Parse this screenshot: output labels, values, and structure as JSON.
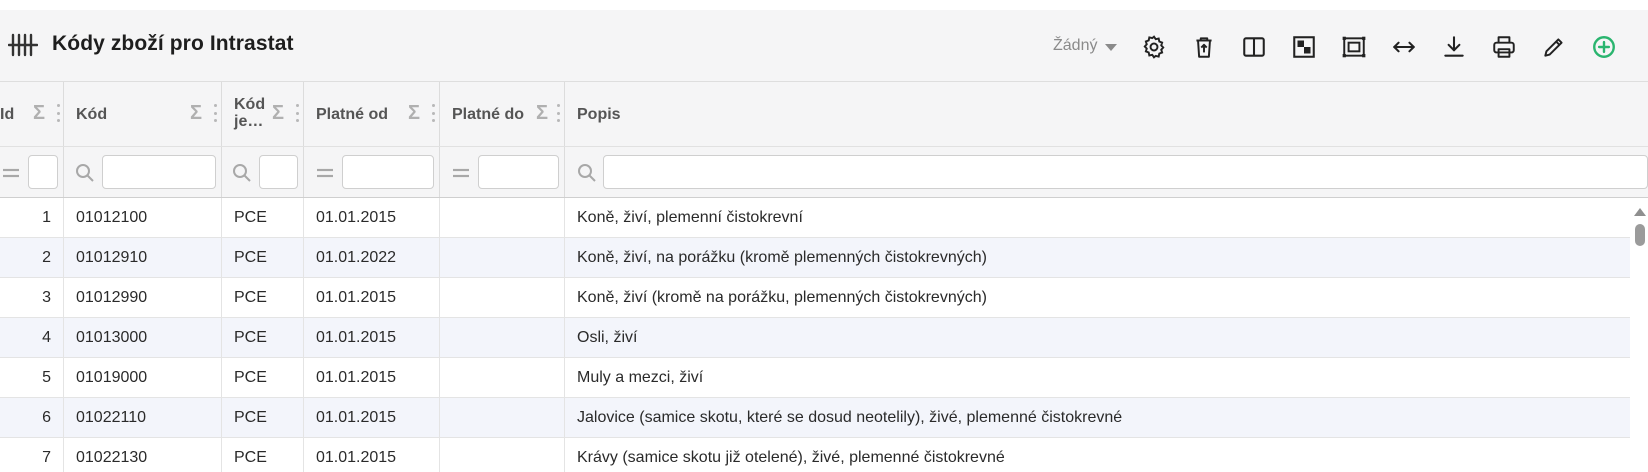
{
  "header": {
    "title": "Kódy zboží pro Intrastat",
    "dropdown_value": "Žádný",
    "tools": [
      {
        "name": "settings-icon"
      },
      {
        "name": "delete-icon"
      },
      {
        "name": "split-view-icon"
      },
      {
        "name": "checkerboard-icon"
      },
      {
        "name": "fit-frame-icon"
      },
      {
        "name": "expand-width-icon"
      },
      {
        "name": "download-icon"
      },
      {
        "name": "print-icon"
      },
      {
        "name": "edit-icon"
      },
      {
        "name": "add-icon"
      }
    ],
    "accent_color": "#2ab56f"
  },
  "columns": [
    {
      "key": "id",
      "label": "Id",
      "filter": "equals"
    },
    {
      "key": "kod",
      "label": "Kód",
      "filter": "search"
    },
    {
      "key": "kod_je",
      "label": "Kód je…",
      "filter": "search"
    },
    {
      "key": "platne_od",
      "label": "Platné od",
      "filter": "equals"
    },
    {
      "key": "platne_do",
      "label": "Platné do",
      "filter": "equals"
    },
    {
      "key": "popis",
      "label": "Popis",
      "filter": "search"
    }
  ],
  "rows": [
    {
      "id": "1",
      "kod": "01012100",
      "kod_je": "PCE",
      "platne_od": "01.01.2015",
      "platne_do": "",
      "popis": "Koně, živí, plemenní čistokrevní"
    },
    {
      "id": "2",
      "kod": "01012910",
      "kod_je": "PCE",
      "platne_od": "01.01.2022",
      "platne_do": "",
      "popis": "Koně, živí, na porážku (kromě plemenných čistokrevných)"
    },
    {
      "id": "3",
      "kod": "01012990",
      "kod_je": "PCE",
      "platne_od": "01.01.2015",
      "platne_do": "",
      "popis": "Koně, živí (kromě na porážku, plemenných čistokrevných)"
    },
    {
      "id": "4",
      "kod": "01013000",
      "kod_je": "PCE",
      "platne_od": "01.01.2015",
      "platne_do": "",
      "popis": "Osli, živí"
    },
    {
      "id": "5",
      "kod": "01019000",
      "kod_je": "PCE",
      "platne_od": "01.01.2015",
      "platne_do": "",
      "popis": "Muly a mezci, živí"
    },
    {
      "id": "6",
      "kod": "01022110",
      "kod_je": "PCE",
      "platne_od": "01.01.2015",
      "platne_do": "",
      "popis": "Jalovice (samice skotu, které se dosud neotelily), živé, plemenné čistokrevné"
    },
    {
      "id": "7",
      "kod": "01022130",
      "kod_je": "PCE",
      "platne_od": "01.01.2015",
      "platne_do": "",
      "popis": "Krávy (samice skotu již otelené), živé, plemenné čistokrevné"
    }
  ]
}
